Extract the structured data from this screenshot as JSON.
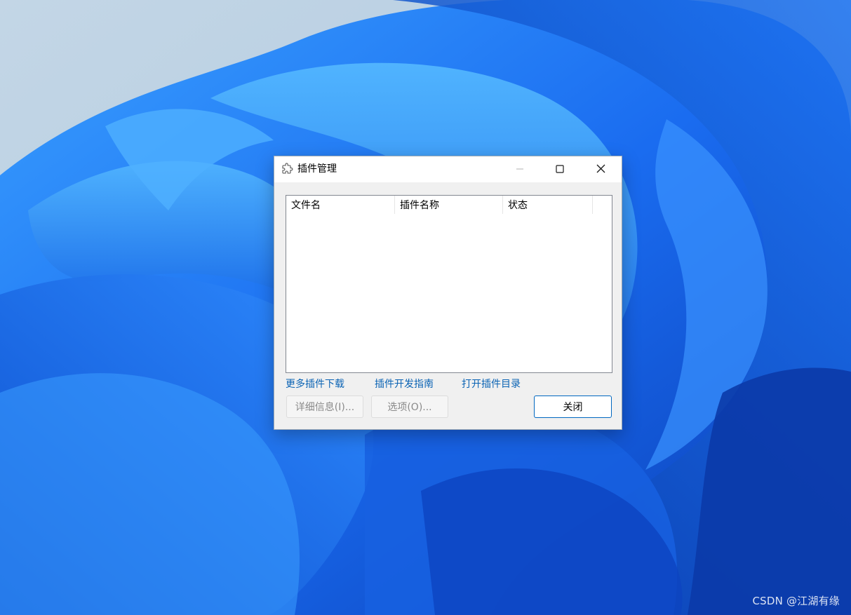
{
  "dialog": {
    "title": "插件管理",
    "title_icon": "puzzle-icon",
    "window_controls": [
      "minimize-icon",
      "maximize-icon",
      "close-icon"
    ]
  },
  "plugin_list": {
    "columns": [
      "文件名",
      "插件名称",
      "状态"
    ],
    "rows": []
  },
  "links": {
    "more_plugins": "更多插件下载",
    "dev_guide": "插件开发指南",
    "open_dir": "打开插件目录"
  },
  "buttons": {
    "details": "详细信息(I)...",
    "options": "选项(O)...",
    "close": "关闭"
  },
  "watermark": "CSDN @江湖有缘",
  "colors": {
    "link": "#0a63b4",
    "accent_border": "#0067c0",
    "wallpaper_blue": "#1f6fe6"
  }
}
